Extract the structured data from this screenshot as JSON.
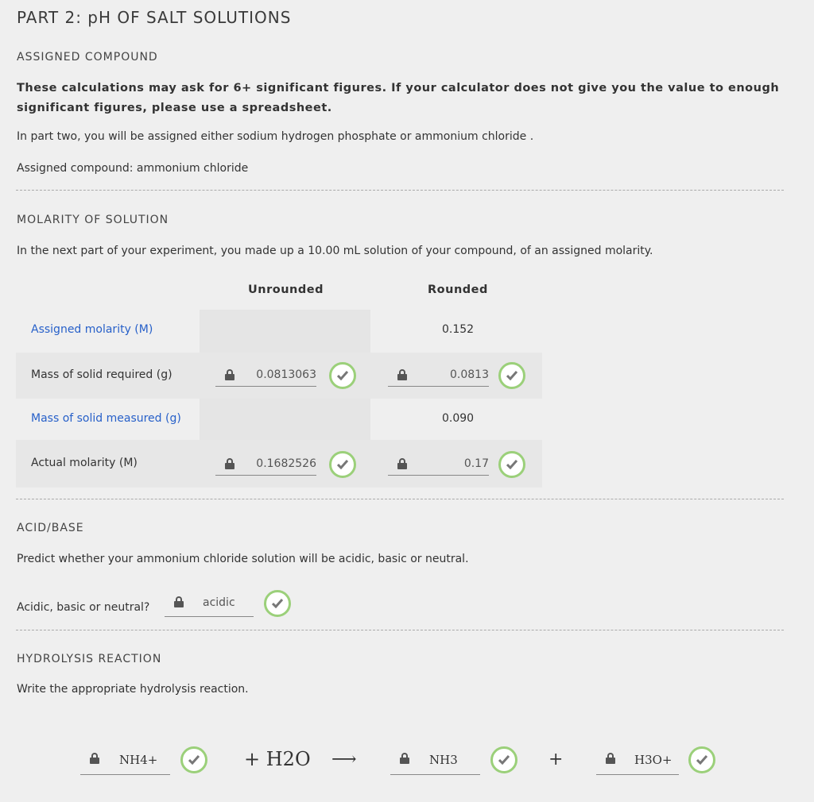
{
  "page": {
    "title": "PART 2: pH OF SALT SOLUTIONS"
  },
  "assigned_compound": {
    "heading": "ASSIGNED COMPOUND",
    "note": "These calculations may ask for 6+ significant figures. If your calculator does not give you the value to enough significant figures, please use a spreadsheet.",
    "intro": "In part two, you will be assigned either sodium hydrogen phosphate or ammonium chloride .",
    "assigned": "Assigned compound: ammonium chloride"
  },
  "molarity": {
    "heading": "MOLARITY OF SOLUTION",
    "intro": "In the next part of your experiment, you made up a 10.00 mL solution of your compound, of an assigned molarity.",
    "col_unrounded": "Unrounded",
    "col_rounded": "Rounded",
    "rows": [
      {
        "label": "Assigned molarity (M)",
        "unrounded": "",
        "rounded": "0.152"
      },
      {
        "label": "Mass of solid required (g)",
        "unrounded": "0.0813063",
        "rounded": "0.0813"
      },
      {
        "label": "Mass of solid measured (g)",
        "unrounded": "",
        "rounded": "0.090"
      },
      {
        "label": "Actual molarity (M)",
        "unrounded": "0.1682526",
        "rounded": "0.17"
      }
    ]
  },
  "acid_base": {
    "heading": "ACID/BASE",
    "intro": "Predict whether your ammonium chloride solution will be acidic, basic or neutral.",
    "question": "Acidic, basic or neutral?",
    "answer": "acidic"
  },
  "hydrolysis": {
    "heading": "HYDROLYSIS REACTION",
    "intro": "Write the appropriate hydrolysis reaction.",
    "reactant1": "NH4+",
    "plus_water": "+ H2O",
    "arrow": "⟶",
    "product1": "NH3",
    "plus": "+",
    "product2": "H3O+"
  },
  "colors": {
    "accent_link": "#2760c9",
    "check_ring": "#9bd07a",
    "check_mark": "#777777"
  }
}
